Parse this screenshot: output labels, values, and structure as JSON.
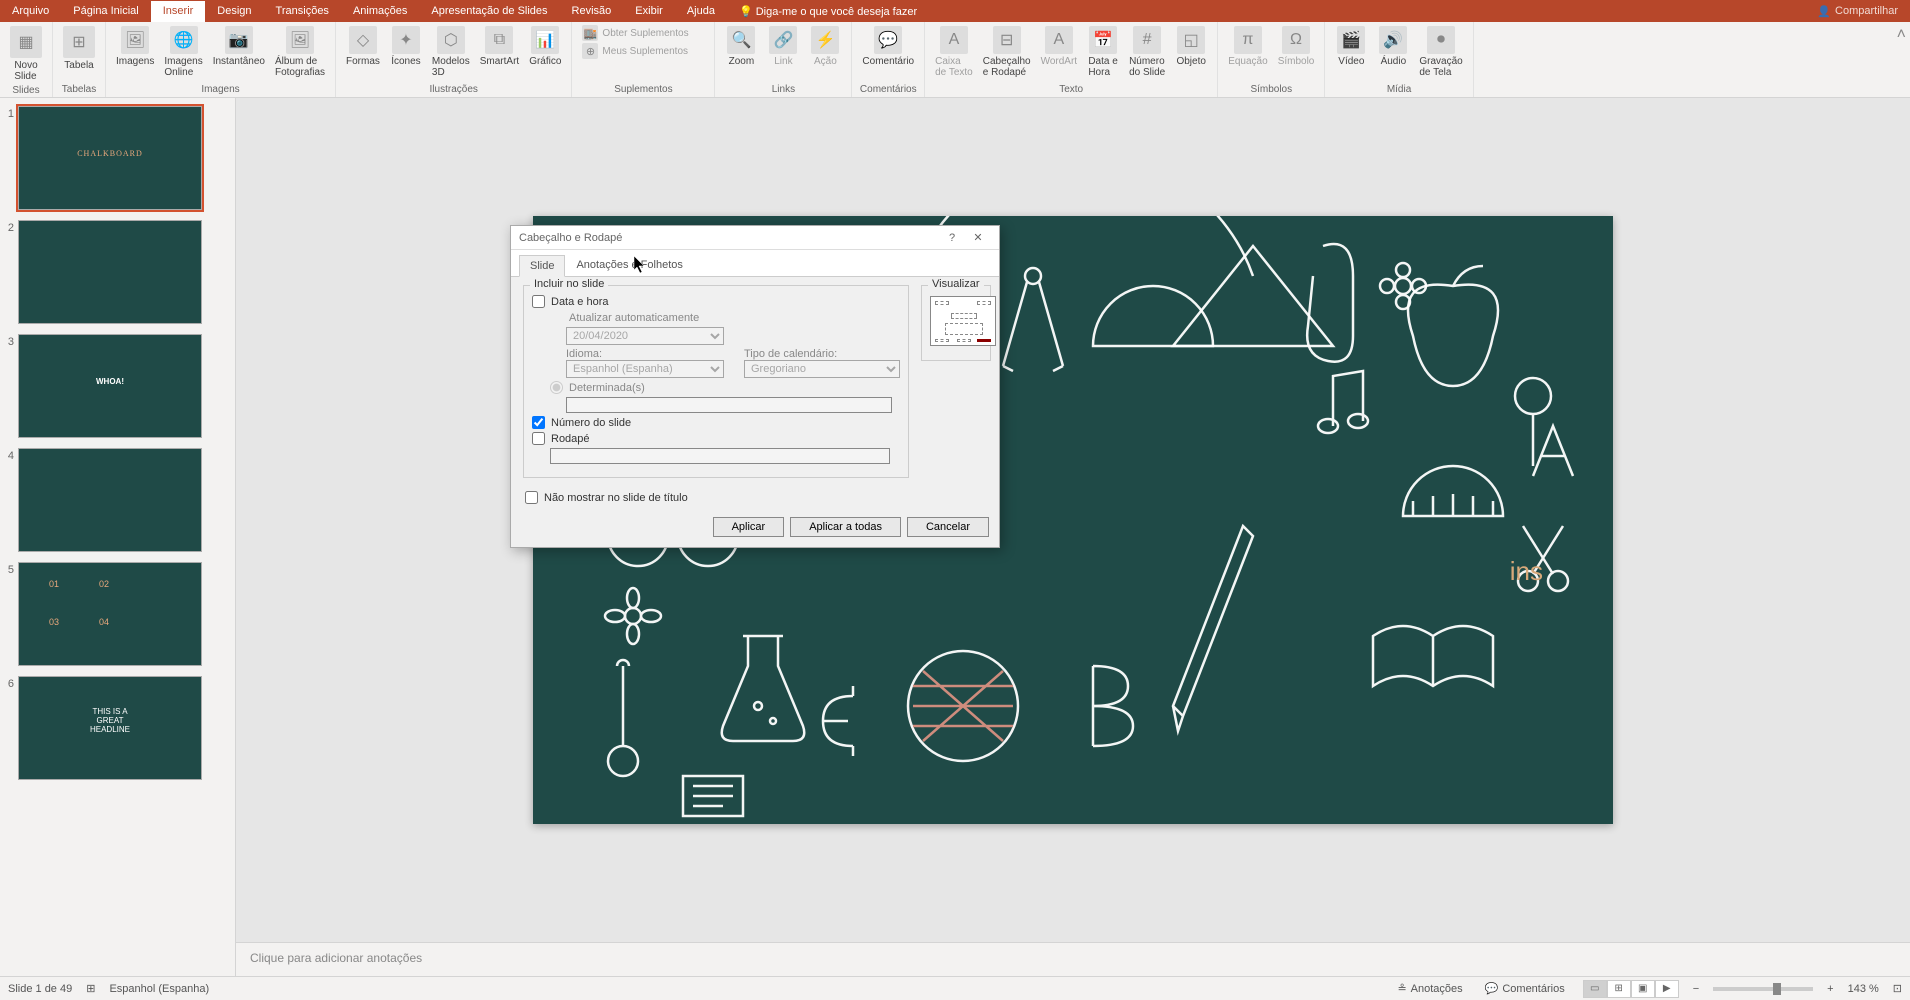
{
  "tabs": {
    "arquivo": "Arquivo",
    "pagina_inicial": "Página Inicial",
    "inserir": "Inserir",
    "design": "Design",
    "transicoes": "Transições",
    "animacoes": "Animações",
    "apresentacao": "Apresentação de Slides",
    "revisao": "Revisão",
    "exibir": "Exibir",
    "ajuda": "Ajuda",
    "tellme": "Diga-me o que você deseja fazer"
  },
  "share": "Compartilhar",
  "ribbon": {
    "novo_slide": "Novo\nSlide",
    "slides": "Slides",
    "tabela": "Tabela",
    "tabelas": "Tabelas",
    "imagens": "Imagens",
    "imagens_online": "Imagens\nOnline",
    "instantaneo": "Instantâneo",
    "album": "Álbum de\nFotografias",
    "grp_imagens": "Imagens",
    "formas": "Formas",
    "icones": "Ícones",
    "modelos3d": "Modelos\n3D",
    "smartart": "SmartArt",
    "grafico": "Gráfico",
    "ilustracoes": "Ilustrações",
    "obter_supl": "Obter Suplementos",
    "meus_supl": "Meus Suplementos",
    "suplementos": "Suplementos",
    "zoom": "Zoom",
    "link": "Link",
    "acao": "Ação",
    "links": "Links",
    "comentario": "Comentário",
    "comentarios": "Comentários",
    "caixa_texto": "Caixa\nde Texto",
    "cabecalho_rodape": "Cabeçalho\ne Rodapé",
    "wordart": "WordArt",
    "data_hora": "Data e\nHora",
    "numero_slide": "Número\ndo Slide",
    "objeto": "Objeto",
    "texto": "Texto",
    "equacao": "Equação",
    "simbolo": "Símbolo",
    "simbolos": "Símbolos",
    "video": "Vídeo",
    "audio": "Áudio",
    "gravacao": "Gravação\nde Tela",
    "midia": "Mídia"
  },
  "thumbs": [
    "1",
    "2",
    "3",
    "4",
    "5",
    "6"
  ],
  "thumb1_title": "CHALKBOARD",
  "thumb3_title": "WHOA!",
  "thumb_headline": "THIS IS A\nGREAT\nHEADLINE",
  "notes_placeholder": "Clique para adicionar anotações",
  "dialog": {
    "title": "Cabeçalho e Rodapé",
    "help": "?",
    "close": "✕",
    "tab_slide": "Slide",
    "tab_notes": "Anotações e Folhetos",
    "incluir": "Incluir no slide",
    "data_hora": "Data e hora",
    "atualizar_auto": "Atualizar automaticamente",
    "data_val": "20/04/2020",
    "idioma_lbl": "Idioma:",
    "idioma_val": "Espanhol (Espanha)",
    "tipo_cal_lbl": "Tipo de calendário:",
    "tipo_cal_val": "Gregoriano",
    "determinadas": "Determinada(s)",
    "numero_slide": "Número do slide",
    "rodape": "Rodapé",
    "nao_mostrar": "Não mostrar no slide de título",
    "visualizar": "Visualizar",
    "aplicar": "Aplicar",
    "aplicar_todas": "Aplicar a todas",
    "cancelar": "Cancelar"
  },
  "status": {
    "slide_count": "Slide 1 de 49",
    "idioma": "Espanhol (Espanha)",
    "anotacoes": "Anotações",
    "comentarios": "Comentários",
    "zoom": "143 %"
  },
  "slide_text": "ins"
}
